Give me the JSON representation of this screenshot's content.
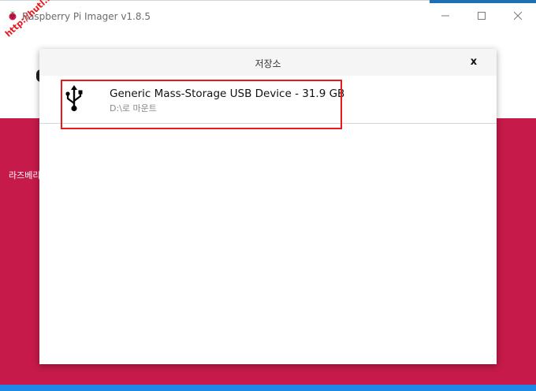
{
  "window": {
    "title": "Raspberry Pi Imager v1.8.5",
    "controls": {
      "minimize": "—",
      "maximize": "☐",
      "close": "✕"
    }
  },
  "app": {
    "left_text": "라즈베리"
  },
  "dialog": {
    "title": "저장소",
    "close_label": "x",
    "items": [
      {
        "icon": "usb-icon",
        "name": "Generic Mass-Storage USB Device - 31.9 GB",
        "mount": "D:\\로 마운트"
      }
    ]
  },
  "watermark": "http://hutl.kr",
  "colors": {
    "pink": "#c51a4a",
    "highlight": "#e8191d",
    "taskbar_blue": "#1e88e5"
  }
}
